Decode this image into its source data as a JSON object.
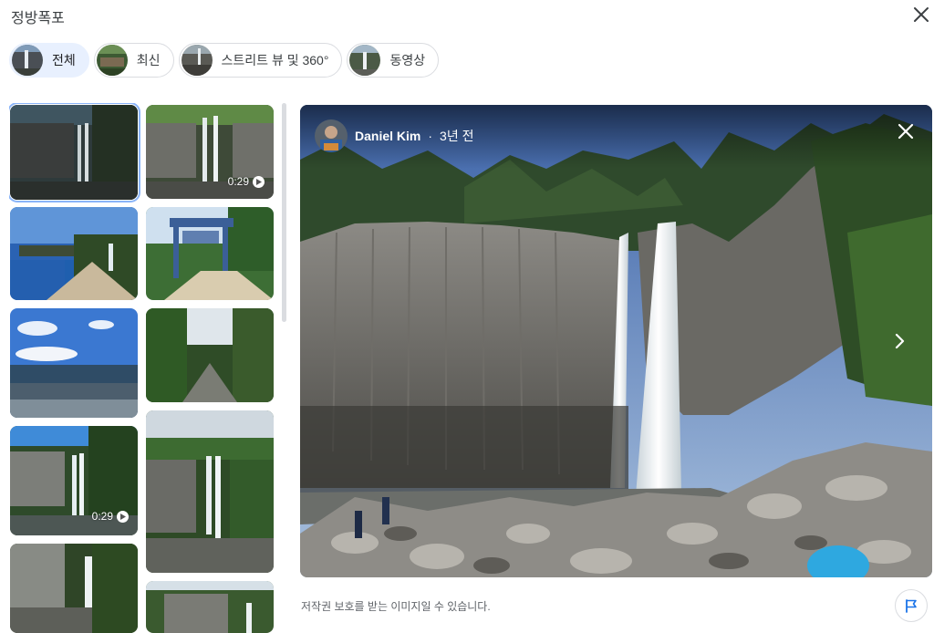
{
  "header": {
    "title": "정방폭포"
  },
  "chips": [
    {
      "label": "전체",
      "active": true
    },
    {
      "label": "최신",
      "active": false
    },
    {
      "label": "스트리트 뷰 및 360°",
      "active": false
    },
    {
      "label": "동영상",
      "active": false
    }
  ],
  "grid": {
    "video_durations": [
      "0:29",
      "0:29"
    ]
  },
  "viewer": {
    "author_name": "Daniel Kim",
    "separator": "·",
    "time_ago": "3년 전"
  },
  "footer": {
    "copyright_notice": "저작권 보호를 받는 이미지일 수 있습니다."
  },
  "icons": {
    "close": "close-icon",
    "next": "chevron-right-icon",
    "flag": "flag-icon",
    "play": "play-icon"
  },
  "colors": {
    "chip_active_bg": "#e8f0fe",
    "flag_blue": "#1a73e8",
    "selected_outline": "#8ab4f8"
  }
}
